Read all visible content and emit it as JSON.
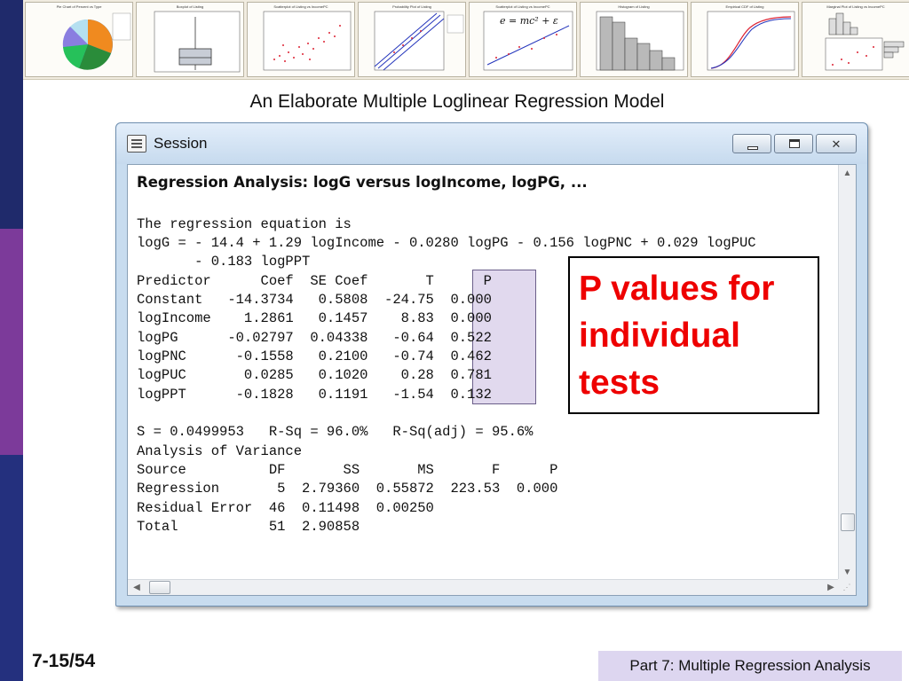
{
  "slide": {
    "title": "An Elaborate Multiple Loglinear Regression Model",
    "slide_number": "7-15/54",
    "footer": "Part 7: Multiple Regression Analysis",
    "colors": {
      "bar_dark": "#1f2a6b",
      "bar_mid": "#2d3da0",
      "bar_purple": "#7c3a9a",
      "callout_red": "#ee0000",
      "highlight": "#e1d9ee"
    }
  },
  "thumbnails": [
    {
      "label": "Pie Chart of Percent vs Type",
      "icon": "pie-chart-icon"
    },
    {
      "label": "Boxplot of Listing",
      "icon": "boxplot-icon"
    },
    {
      "label": "Scatterplot of Listing vs IncomePC",
      "icon": "scatter-icon"
    },
    {
      "label": "Probability Plot of Listing",
      "icon": "probability-plot-icon"
    },
    {
      "label": "Scatterplot of Listing vs IncomePC",
      "icon": "scatter-line-icon",
      "formula": "e = mc² + ε"
    },
    {
      "label": "Histogram of Listing",
      "icon": "histogram-icon"
    },
    {
      "label": "Empirical CDF of Listing",
      "icon": "cdf-icon"
    },
    {
      "label": "Marginal Plot of Listing vs IncomePC",
      "icon": "marginal-plot-icon"
    }
  ],
  "session": {
    "window_title": "Session",
    "controls": {
      "minimize": "minimize",
      "maximize": "maximize",
      "close": "✕"
    },
    "heading": "Regression Analysis: logG versus logIncome, logPG, ...",
    "equation": [
      "The regression equation is",
      "logG = - 14.4 + 1.29 logIncome - 0.0280 logPG - 0.156 logPNC + 0.029 logPUC",
      "       - 0.183 logPPT"
    ],
    "coef_table": {
      "header": "Predictor      Coef  SE Coef       T      P",
      "rows": [
        "Constant   -14.3734   0.5808  -24.75  0.000",
        "logIncome    1.2861   0.1457    8.83  0.000",
        "logPG      -0.02797  0.04338   -0.64  0.522",
        "logPNC      -0.1558   0.2100   -0.74  0.462",
        "logPUC       0.0285   0.1020    0.28  0.781",
        "logPPT      -0.1828   0.1191   -1.54  0.132"
      ]
    },
    "fit_stats": "S = 0.0499953   R-Sq = 96.0%   R-Sq(adj) = 95.6%",
    "anova": {
      "title": "Analysis of Variance",
      "header": "Source          DF       SS       MS       F      P",
      "rows": [
        "Regression       5  2.79360  0.55872  223.53  0.000",
        "Residual Error  46  0.11498  0.00250",
        "Total           51  2.90858"
      ]
    },
    "scroll": {
      "up": "▲",
      "down": "▼",
      "left": "◀",
      "right": "▶",
      "grip": "⋰"
    }
  },
  "callout": {
    "text": "P values for individual tests"
  }
}
